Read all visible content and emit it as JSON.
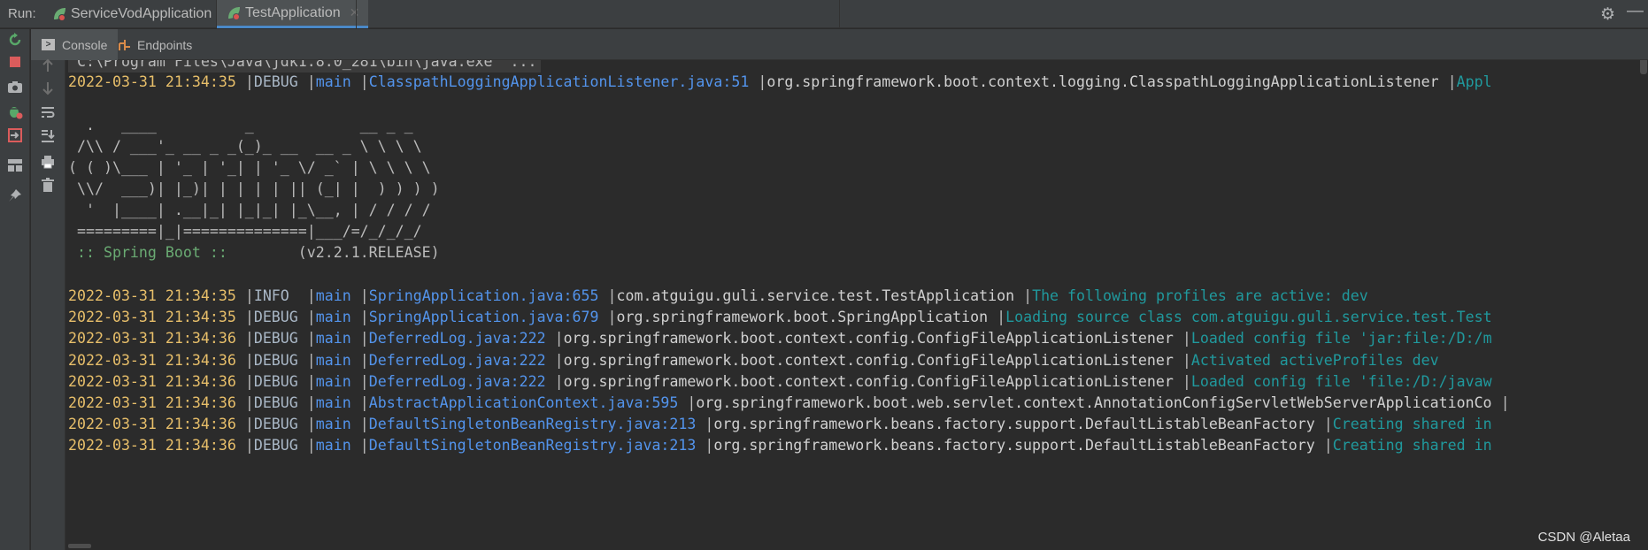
{
  "run_bar": {
    "label": "Run:",
    "tabs": [
      {
        "label": "ServiceVodApplication",
        "active": false
      },
      {
        "label": "TestApplication",
        "active": true
      }
    ]
  },
  "sub_tabs": [
    {
      "label": "Console",
      "active": true
    },
    {
      "label": "Endpoints",
      "active": false
    }
  ],
  "console": {
    "command": "\"C:\\Program Files\\Java\\jdk1.8.0_281\\bin\\java.exe\" ...",
    "first_log": {
      "ts": "2022-03-31 21:34:35",
      "level": "DEBUG",
      "thread": "main",
      "loc": "ClasspathLoggingApplicationListener.java:51",
      "cls": "org.springframework.boot.context.logging.ClasspathLoggingApplicationListener",
      "msg": "Appl"
    },
    "banner": [
      "  .   ____          _            __ _ _",
      " /\\\\ / ___'_ __ _ _(_)_ __  __ _ \\ \\ \\ \\",
      "( ( )\\___ | '_ | '_| | '_ \\/ _` | \\ \\ \\ \\",
      " \\\\/  ___)| |_)| | | | | || (_| |  ) ) ) )",
      "  '  |____| .__|_| |_|_| |_\\__, | / / / /",
      " =========|_|==============|___/=/_/_/_/"
    ],
    "spring_boot_label": " :: Spring Boot :: ",
    "spring_boot_version": "       (v2.2.1.RELEASE)",
    "logs": [
      {
        "ts": "2022-03-31 21:34:35",
        "level": "INFO ",
        "thread": "main",
        "loc": "SpringApplication.java:655",
        "cls": "com.atguigu.guli.service.test.TestApplication",
        "msg": "The following profiles are active: dev"
      },
      {
        "ts": "2022-03-31 21:34:35",
        "level": "DEBUG",
        "thread": "main",
        "loc": "SpringApplication.java:679",
        "cls": "org.springframework.boot.SpringApplication",
        "msg": "Loading source class com.atguigu.guli.service.test.Test"
      },
      {
        "ts": "2022-03-31 21:34:36",
        "level": "DEBUG",
        "thread": "main",
        "loc": "DeferredLog.java:222",
        "cls": "org.springframework.boot.context.config.ConfigFileApplicationListener",
        "msg": "Loaded config file 'jar:file:/D:/m"
      },
      {
        "ts": "2022-03-31 21:34:36",
        "level": "DEBUG",
        "thread": "main",
        "loc": "DeferredLog.java:222",
        "cls": "org.springframework.boot.context.config.ConfigFileApplicationListener",
        "msg": "Activated activeProfiles dev"
      },
      {
        "ts": "2022-03-31 21:34:36",
        "level": "DEBUG",
        "thread": "main",
        "loc": "DeferredLog.java:222",
        "cls": "org.springframework.boot.context.config.ConfigFileApplicationListener",
        "msg": "Loaded config file 'file:/D:/javaw"
      },
      {
        "ts": "2022-03-31 21:34:36",
        "level": "DEBUG",
        "thread": "main",
        "loc": "AbstractApplicationContext.java:595",
        "cls": "org.springframework.boot.web.servlet.context.AnnotationConfigServletWebServerApplicationCo",
        "msg": ""
      },
      {
        "ts": "2022-03-31 21:34:36",
        "level": "DEBUG",
        "thread": "main",
        "loc": "DefaultSingletonBeanRegistry.java:213",
        "cls": "org.springframework.beans.factory.support.DefaultListableBeanFactory",
        "msg": "Creating shared in"
      },
      {
        "ts": "2022-03-31 21:34:36",
        "level": "DEBUG",
        "thread": "main",
        "loc": "DefaultSingletonBeanRegistry.java:213",
        "cls": "org.springframework.beans.factory.support.DefaultListableBeanFactory",
        "msg": "Creating shared in"
      }
    ]
  },
  "watermark": "CSDN @Aletaa",
  "colors": {
    "timestamp": "#e8bf6a",
    "thread": "#5394ec",
    "message": "#20999d",
    "spring_boot": "#6aab73",
    "accent": "#4a88c7"
  }
}
